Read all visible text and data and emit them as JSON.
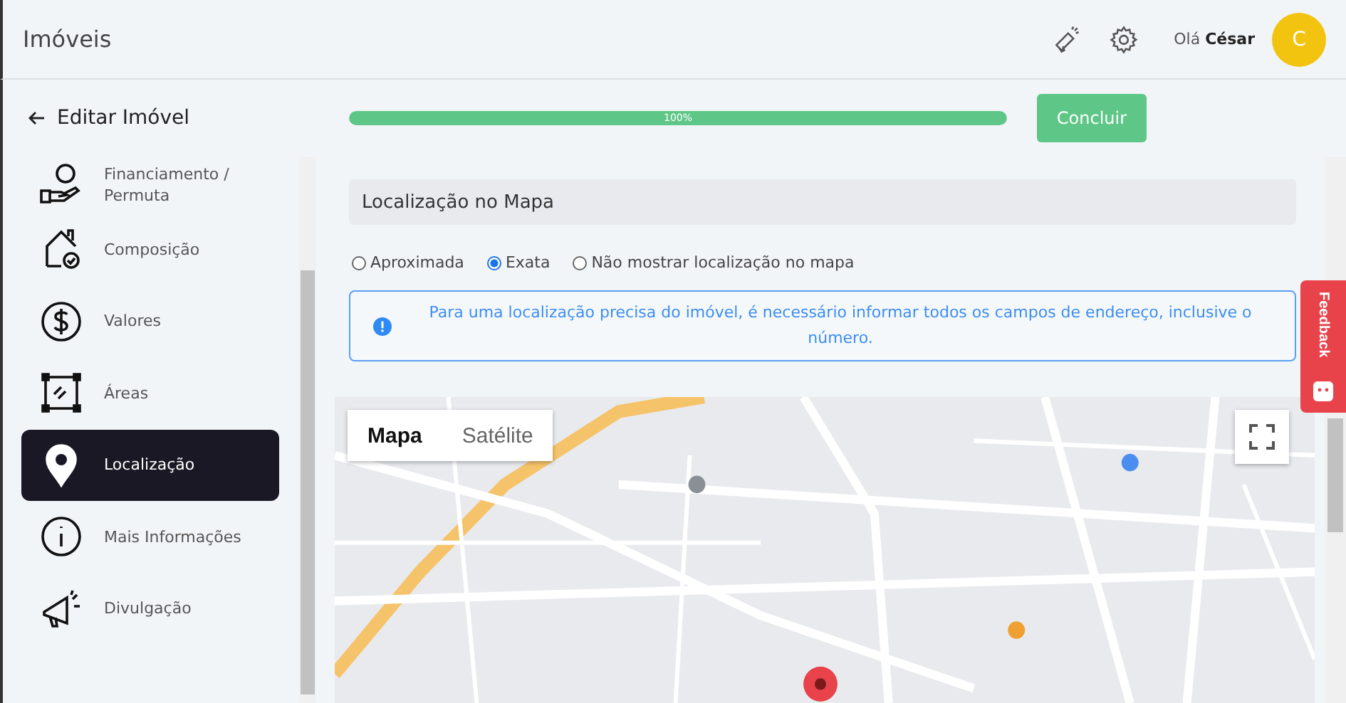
{
  "header": {
    "title": "Imóveis",
    "greeting": "Olá",
    "user": "César",
    "avatar": "C"
  },
  "subheader": {
    "title": "Editar Imóvel",
    "progress": {
      "level": 1,
      "label": "100%"
    },
    "button": "Concluir"
  },
  "sidebar": {
    "items": [
      {
        "label": "Financiamento / Permuta",
        "selected": false
      },
      {
        "label": "Composição",
        "selected": false
      },
      {
        "label": "Valores",
        "selected": false
      },
      {
        "label": "Áreas",
        "selected": false
      },
      {
        "label": "Localização",
        "selected": true
      },
      {
        "label": "Mais Informações",
        "selected": false
      },
      {
        "label": "Divulgação",
        "selected": false
      }
    ]
  },
  "section": {
    "title": "Localização no Mapa"
  },
  "radios": [
    {
      "label": "Aproximada",
      "selected": false
    },
    {
      "label": "Exata",
      "selected": true
    },
    {
      "label": "Não mostrar localização no mapa",
      "selected": false
    }
  ],
  "alert": {
    "text": "Para uma localização precisa do imóvel, é necessário informar todos os campos de endereço, inclusive o número."
  },
  "map": {
    "kind": "picture",
    "types": [
      {
        "label": "Mapa",
        "selected": true
      },
      {
        "label": "Satélite",
        "selected": false
      }
    ]
  },
  "feedback": {
    "label": "Feedback"
  }
}
